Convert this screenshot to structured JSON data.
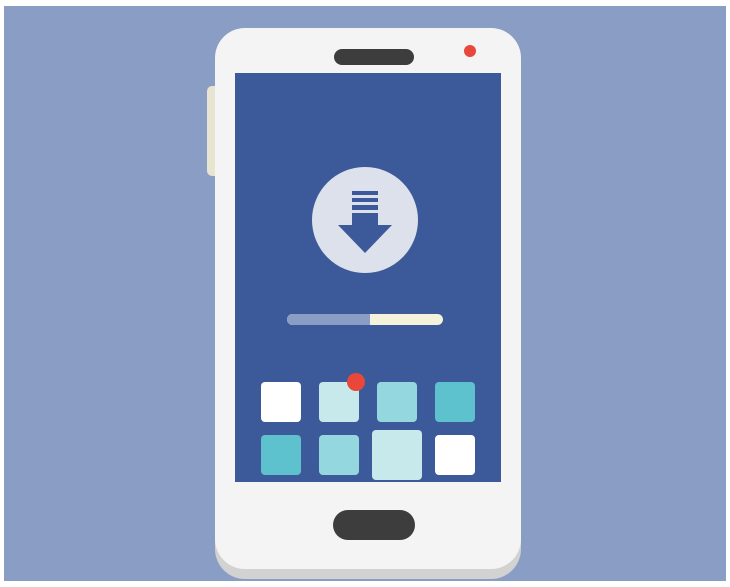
{
  "colors": {
    "background": "#8a9dc5",
    "phone_body": "#f4f4f4",
    "phone_shadow": "#d2d2d2",
    "screen": "#3c5a99",
    "hardware_dark": "#3d3d3d",
    "notification_red": "#e8473a",
    "side_button": "#e7e4cf",
    "icon_circle": "#dde1ec",
    "progress_track": "#f5f2dc",
    "progress_fill": "#8a9dc5"
  },
  "download": {
    "icon": "download-arrow-icon",
    "progress_fraction": 0.53
  },
  "app_grid": {
    "rows": [
      [
        {
          "name": "app-tile-1",
          "color": "#ffffff",
          "badge": false
        },
        {
          "name": "app-tile-2",
          "color": "#c8e9ec",
          "badge": true
        },
        {
          "name": "app-tile-3",
          "color": "#95d7de",
          "badge": false
        },
        {
          "name": "app-tile-4",
          "color": "#5dc2cd",
          "badge": false
        }
      ],
      [
        {
          "name": "app-tile-5",
          "color": "#5dc2cd",
          "badge": false
        },
        {
          "name": "app-tile-6",
          "color": "#95d7de",
          "badge": false
        },
        {
          "name": "app-tile-7",
          "color": "#c8e9ec",
          "badge": false,
          "enlarged": true
        },
        {
          "name": "app-tile-8",
          "color": "#ffffff",
          "badge": false
        }
      ]
    ]
  }
}
